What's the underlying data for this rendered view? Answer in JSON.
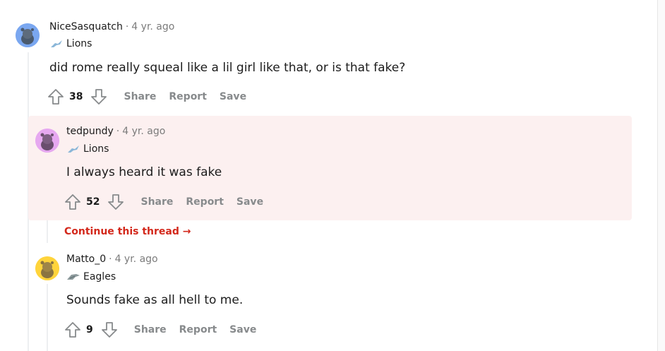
{
  "comments": [
    {
      "author": "NiceSasquatch",
      "time": "4 yr. ago",
      "flair": "Lions",
      "body": "did rome really squeal like a lil girl like that, or is that fake?",
      "score": "38",
      "avatar_color": "#7aa7f0"
    },
    {
      "author": "tedpundy",
      "time": "4 yr. ago",
      "flair": "Lions",
      "body": "I always heard it was fake",
      "score": "52",
      "avatar_color": "#e6a8f0"
    },
    {
      "author": "Matto_0",
      "time": "4 yr. ago",
      "flair": "Eagles",
      "body": "Sounds fake as all hell to me.",
      "score": "9",
      "avatar_color": "#ffd43b"
    }
  ],
  "actions": {
    "share": "Share",
    "report": "Report",
    "save": "Save"
  },
  "continue_thread": "Continue this thread",
  "colors": {
    "highlight_bg": "#fcf0f0",
    "continue_link": "#d3281b",
    "meta_gray": "#7c7c7c"
  }
}
